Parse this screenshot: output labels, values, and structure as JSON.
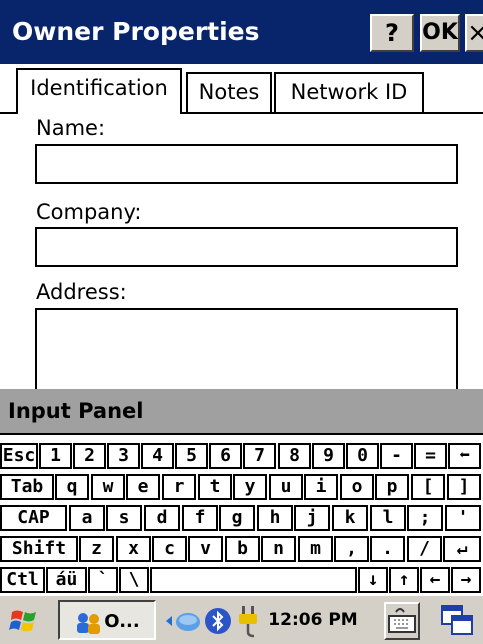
{
  "window": {
    "title": "Owner Properties",
    "help_label": "?",
    "ok_label": "OK",
    "close_label": "×"
  },
  "tabs": [
    {
      "label": "Identification"
    },
    {
      "label": "Notes"
    },
    {
      "label": "Network ID"
    }
  ],
  "form": {
    "name_label": "Name:",
    "name_value": "",
    "company_label": "Company:",
    "company_value": "",
    "address_label": "Address:",
    "address_value": ""
  },
  "input_panel": {
    "title": "Input Panel",
    "rows": [
      [
        "Esc",
        "1",
        "2",
        "3",
        "4",
        "5",
        "6",
        "7",
        "8",
        "9",
        "0",
        "-",
        "=",
        "⬅"
      ],
      [
        "Tab",
        "q",
        "w",
        "e",
        "r",
        "t",
        "y",
        "u",
        "i",
        "o",
        "p",
        "[",
        "]"
      ],
      [
        "CAP",
        "a",
        "s",
        "d",
        "f",
        "g",
        "h",
        "j",
        "k",
        "l",
        ";",
        "'"
      ],
      [
        "Shift",
        "z",
        "x",
        "c",
        "v",
        "b",
        "n",
        "m",
        ",",
        ".",
        "/",
        "↵"
      ],
      [
        "Ctl",
        "áü",
        "`",
        "\\",
        " ",
        "↓",
        "↑",
        "←",
        "→"
      ]
    ]
  },
  "taskbar": {
    "start_icon": "windows-flag-icon",
    "app_label": "O...",
    "clock": "12:06 PM",
    "icons": [
      "network-icon",
      "bluetooth-icon",
      "power-plug-icon",
      "keyboard-icon",
      "window-switch-icon"
    ]
  },
  "colors": {
    "titlebar": "#08246b",
    "chrome": "#d4d0c8",
    "input_panel_header": "#a0a0a0"
  }
}
